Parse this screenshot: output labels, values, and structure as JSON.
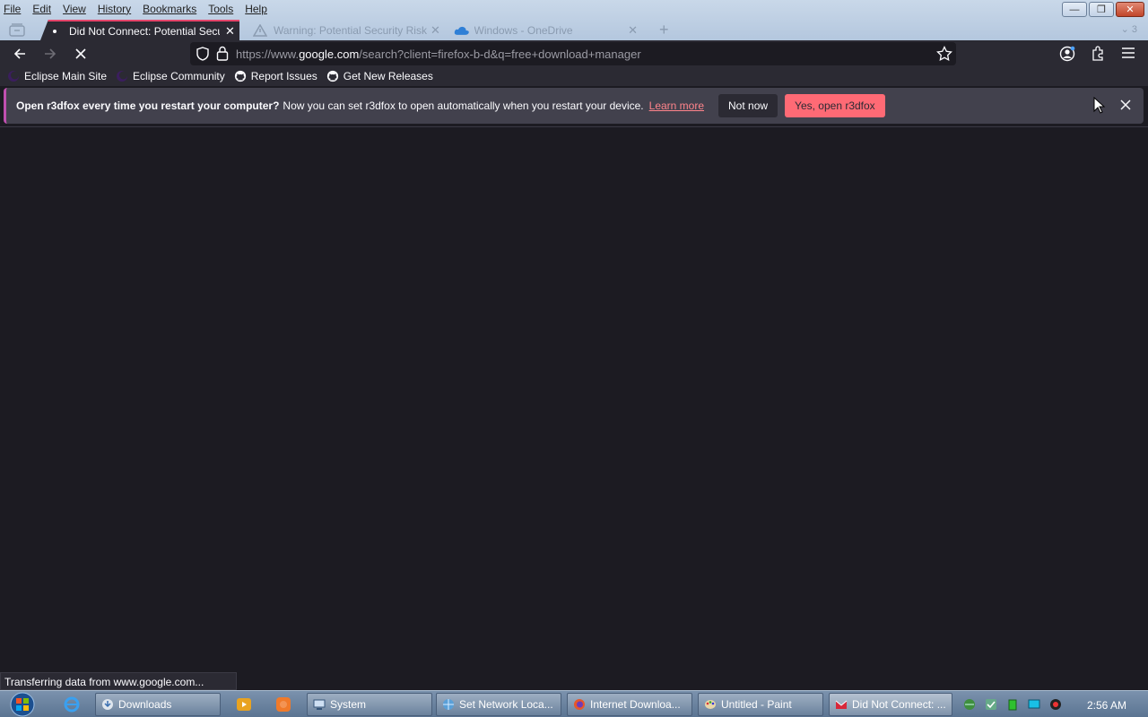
{
  "menubar": [
    "File",
    "Edit",
    "View",
    "History",
    "Bookmarks",
    "Tools",
    "Help"
  ],
  "tabs": [
    {
      "title": "Did Not Connect: Potential Secu",
      "active": true
    },
    {
      "title": "Warning: Potential Security Risk",
      "active": false
    },
    {
      "title": "Windows - OneDrive",
      "active": false
    }
  ],
  "tab_count": "3",
  "url": {
    "prefix": "https://www.",
    "host": "google.com",
    "path": "/search?client=firefox-b-d&q=free+download+manager"
  },
  "bookmarks": [
    {
      "label": "Eclipse Main Site",
      "icon": "eclipse-icon"
    },
    {
      "label": "Eclipse Community",
      "icon": "eclipse-icon"
    },
    {
      "label": "Report Issues",
      "icon": "github-icon"
    },
    {
      "label": "Get New Releases",
      "icon": "github-icon"
    }
  ],
  "notification": {
    "bold": "Open r3dfox every time you restart your computer?",
    "text": "Now you can set r3dfox to open automatically when you restart your device.",
    "link": "Learn more",
    "not_now": "Not now",
    "yes": "Yes, open r3dfox"
  },
  "status": "Transferring data from www.google.com...",
  "taskbar": {
    "items": [
      {
        "label": "Downloads",
        "icon": "downloads-icon"
      },
      {
        "label": "System",
        "icon": "system-icon"
      },
      {
        "label": "Set Network Loca...",
        "icon": "network-icon"
      },
      {
        "label": "Internet Downloa...",
        "icon": "firefox-icon"
      },
      {
        "label": "Untitled - Paint",
        "icon": "paint-icon"
      },
      {
        "label": "Did Not Connect: ...",
        "icon": "r3dfox-icon"
      }
    ],
    "clock": "2:56 AM"
  },
  "colors": {
    "accent": "#ff6a75",
    "link": "#ff848b",
    "tab_border": "#e5456a",
    "page_bg": "#1c1b22"
  }
}
